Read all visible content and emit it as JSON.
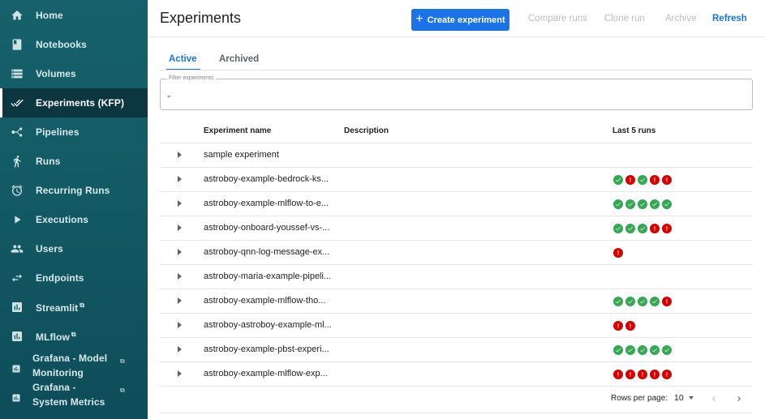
{
  "sidebar": {
    "items": [
      {
        "label": "Home",
        "icon": "home-icon"
      },
      {
        "label": "Notebooks",
        "icon": "book-icon"
      },
      {
        "label": "Volumes",
        "icon": "storage-icon"
      },
      {
        "label": "Experiments (KFP)",
        "icon": "done-all-icon",
        "active": true
      },
      {
        "label": "Pipelines",
        "icon": "pipeline-icon"
      },
      {
        "label": "Runs",
        "icon": "run-icon"
      },
      {
        "label": "Recurring Runs",
        "icon": "alarm-icon"
      },
      {
        "label": "Executions",
        "icon": "play-icon"
      },
      {
        "label": "Users",
        "icon": "users-icon"
      },
      {
        "label": "Endpoints",
        "icon": "arrows-icon"
      },
      {
        "label": "Streamlit",
        "icon": "bar-chart-icon",
        "external": true
      },
      {
        "label": "MLflow",
        "icon": "bar-chart-icon",
        "external": true
      },
      {
        "label": "Grafana - Model Monitoring",
        "icon": "bar-chart-icon",
        "external": true
      },
      {
        "label": "Grafana - System Metrics",
        "icon": "bar-chart-icon",
        "external": true
      }
    ]
  },
  "header": {
    "title": "Experiments",
    "create_label": "Create experiment",
    "compare_label": "Compare runs",
    "clone_label": "Clone run",
    "archive_label": "Archive",
    "refresh_label": "Refresh"
  },
  "tabs": {
    "active_label": "Active",
    "archived_label": "Archived"
  },
  "filter": {
    "label": "Filter experiments",
    "icon": "filter-icon"
  },
  "table": {
    "columns": {
      "name": "Experiment name",
      "description": "Description",
      "last_runs": "Last 5 runs"
    },
    "rows": [
      {
        "name": "sample experiment",
        "runs": []
      },
      {
        "name": "astroboy-example-bedrock-ks...",
        "runs": [
          "ok",
          "fail",
          "ok",
          "fail",
          "fail"
        ]
      },
      {
        "name": "astroboy-example-mlflow-to-e...",
        "runs": [
          "ok",
          "ok",
          "ok",
          "ok",
          "ok"
        ]
      },
      {
        "name": "astroboy-onboard-youssef-vs-...",
        "runs": [
          "ok",
          "ok",
          "ok",
          "fail",
          "fail"
        ]
      },
      {
        "name": "astroboy-qnn-log-message-ex...",
        "runs": [
          "fail"
        ]
      },
      {
        "name": "astroboy-maria-example-pipeli...",
        "runs": []
      },
      {
        "name": "astroboy-example-mlflow-tho...",
        "runs": [
          "ok",
          "ok",
          "ok",
          "ok",
          "fail"
        ]
      },
      {
        "name": "astroboy-astroboy-example-ml...",
        "runs": [
          "fail",
          "fail"
        ]
      },
      {
        "name": "astroboy-example-pbst-experi...",
        "runs": [
          "ok",
          "ok",
          "ok",
          "ok",
          "ok"
        ]
      },
      {
        "name": "astroboy-example-mlflow-exp...",
        "runs": [
          "fail",
          "fail",
          "fail",
          "fail",
          "fail"
        ]
      }
    ]
  },
  "pagination": {
    "rows_per_page_label": "Rows per page:",
    "rows_per_page_value": "10"
  },
  "colors": {
    "accent": "#1a73e8",
    "success": "#34a853",
    "error": "#d50000",
    "sidebar": "#135a65"
  }
}
